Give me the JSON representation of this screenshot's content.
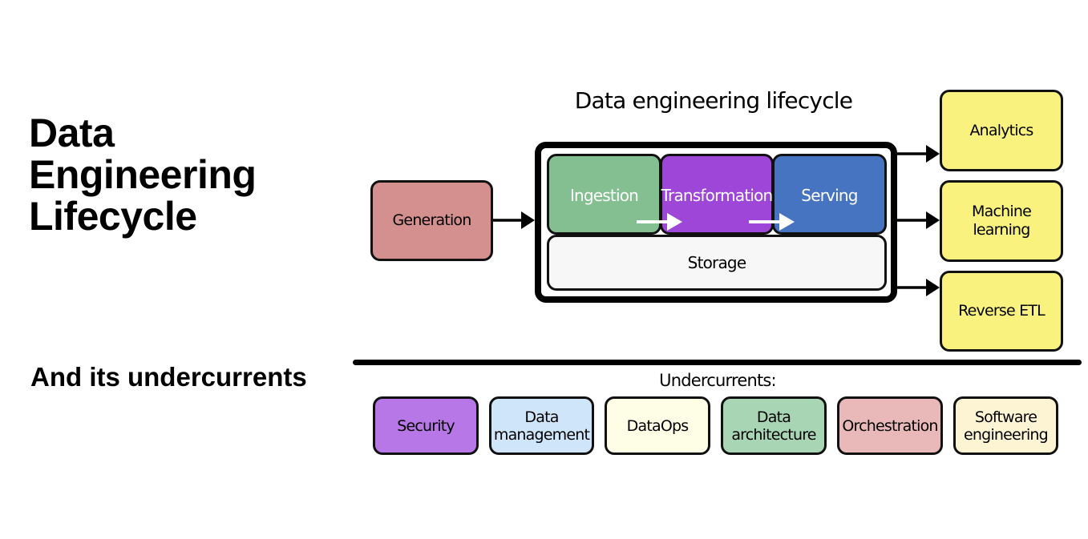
{
  "page": {
    "title_lines": [
      "Data",
      "Engineering",
      "Lifecycle"
    ],
    "subtitle": "And its undercurrents"
  },
  "diagram": {
    "title": "Data engineering lifecycle",
    "source": {
      "label": "Generation",
      "color": "#d48f8f"
    },
    "stages": [
      {
        "label": "Ingestion",
        "color": "#84bf92"
      },
      {
        "label": "Transformation",
        "color": "#9e46d8"
      },
      {
        "label": "Serving",
        "color": "#4674c1"
      }
    ],
    "storage": {
      "label": "Storage",
      "color": "#f7f7f7"
    },
    "outputs": [
      {
        "label": "Analytics",
        "color": "#f9f27e"
      },
      {
        "label": "Machine\nlearning",
        "color": "#f9f27e"
      },
      {
        "label": "Reverse ETL",
        "color": "#f9f27e"
      }
    ],
    "undercurrents_label": "Undercurrents:",
    "undercurrents": [
      {
        "label": "Security",
        "color": "#b877e6"
      },
      {
        "label": "Data\nmanagement",
        "color": "#cfe5fa"
      },
      {
        "label": "DataOps",
        "color": "#fefde6"
      },
      {
        "label": "Data\narchitecture",
        "color": "#a8d6b5"
      },
      {
        "label": "Orchestration",
        "color": "#e8b9b8"
      },
      {
        "label": "Software\nengineering",
        "color": "#fdf4d3"
      }
    ]
  }
}
